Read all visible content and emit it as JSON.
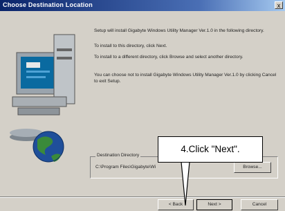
{
  "window": {
    "title": "Choose Destination Location",
    "close_label": "x"
  },
  "body": {
    "para1": "Setup will install Gigabyte Windows Utility Manager Ver.1.0 in the following directory.",
    "para2": "To install to this directory, click Next.",
    "para3": "To install to a different directory, click Browse and select another directory.",
    "para4": "You can choose not to install Gigabyte Windows Utility Manager Ver.1.0 by clicking Cancel to exit Setup."
  },
  "destination": {
    "label": "Destination Directory",
    "path": "C:\\Program Files\\Gigabyte\\Wi"
  },
  "buttons": {
    "browse": "Browse...",
    "back": "< Back",
    "next": "Next >",
    "cancel": "Cancel"
  },
  "callout": {
    "text": "4.Click \"Next\"."
  },
  "colors": {
    "title_bar": "#0a246a",
    "dialog_bg": "#d4d0c8"
  }
}
